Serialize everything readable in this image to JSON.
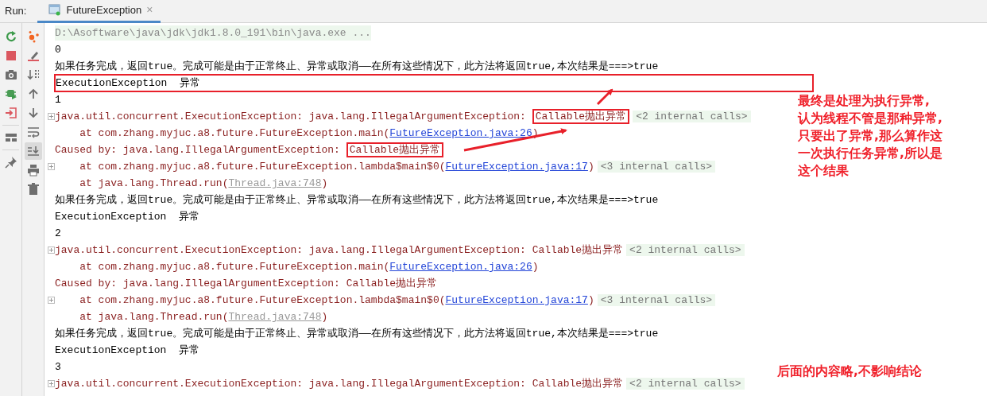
{
  "toolbar": {
    "label": "Run:",
    "tabs": [
      {
        "label": "FutureException",
        "selected": true,
        "close": "×"
      }
    ]
  },
  "console": [
    {
      "kind": "cmd",
      "fold": false,
      "boxed": false,
      "segments": [
        {
          "kind": "text",
          "text": "D:\\Asoftware\\java\\jdk\\jdk1.8.0_191\\bin\\java.exe ..."
        }
      ]
    },
    {
      "kind": "stdout",
      "fold": false,
      "boxed": false,
      "segments": [
        {
          "kind": "text",
          "text": "0"
        }
      ]
    },
    {
      "kind": "stdout",
      "fold": false,
      "boxed": false,
      "segments": [
        {
          "kind": "text",
          "text": "如果任务完成，返回true。完成可能是由于正常终止、异常或取消——在所有这些情况下，此方法将返回true,本次结果是===>true"
        }
      ]
    },
    {
      "kind": "stdout",
      "fold": false,
      "boxed": true,
      "segments": [
        {
          "kind": "text",
          "text": "ExecutionException  异常"
        }
      ]
    },
    {
      "kind": "stdout",
      "fold": false,
      "boxed": false,
      "segments": [
        {
          "kind": "text",
          "text": "1"
        }
      ]
    },
    {
      "kind": "stderr",
      "fold": true,
      "boxed": false,
      "segments": [
        {
          "kind": "text",
          "text": "java.util.concurrent.ExecutionException: java.lang.IllegalArgumentException: "
        },
        {
          "kind": "boxed",
          "text": "Callable抛出异常"
        },
        {
          "kind": "hint",
          "text": "<2 internal calls>"
        }
      ]
    },
    {
      "kind": "stderr",
      "fold": false,
      "boxed": false,
      "segments": [
        {
          "kind": "text",
          "text": "    at com.zhang.myjuc.a8.future.FutureException.main("
        },
        {
          "kind": "link",
          "text": "FutureException.java:26"
        },
        {
          "kind": "text",
          "text": ")"
        }
      ]
    },
    {
      "kind": "stderr",
      "fold": false,
      "boxed": false,
      "segments": [
        {
          "kind": "text",
          "text": "Caused by: java.lang.IllegalArgumentException: "
        },
        {
          "kind": "boxed",
          "text": "Callable抛出异常"
        }
      ]
    },
    {
      "kind": "stderr",
      "fold": true,
      "boxed": false,
      "segments": [
        {
          "kind": "text",
          "text": "    at com.zhang.myjuc.a8.future.FutureException.lambda$main$0("
        },
        {
          "kind": "link",
          "text": "FutureException.java:17"
        },
        {
          "kind": "text",
          "text": ")"
        },
        {
          "kind": "hint",
          "text": "<3 internal calls>"
        }
      ]
    },
    {
      "kind": "stderr",
      "fold": false,
      "boxed": false,
      "segments": [
        {
          "kind": "text",
          "text": "    at java.lang.Thread.run("
        },
        {
          "kind": "dim_link",
          "text": "Thread.java:748"
        },
        {
          "kind": "text",
          "text": ")"
        }
      ]
    },
    {
      "kind": "stdout",
      "fold": false,
      "boxed": false,
      "segments": [
        {
          "kind": "text",
          "text": "如果任务完成，返回true。完成可能是由于正常终止、异常或取消——在所有这些情况下，此方法将返回true,本次结果是===>true"
        }
      ]
    },
    {
      "kind": "stdout",
      "fold": false,
      "boxed": false,
      "segments": [
        {
          "kind": "text",
          "text": "ExecutionException  异常"
        }
      ]
    },
    {
      "kind": "stdout",
      "fold": false,
      "boxed": false,
      "segments": [
        {
          "kind": "text",
          "text": "2"
        }
      ]
    },
    {
      "kind": "stderr",
      "fold": true,
      "boxed": false,
      "segments": [
        {
          "kind": "text",
          "text": "java.util.concurrent.ExecutionException: java.lang.IllegalArgumentException: Callable抛出异常"
        },
        {
          "kind": "hint",
          "text": "<2 internal calls>"
        }
      ]
    },
    {
      "kind": "stderr",
      "fold": false,
      "boxed": false,
      "segments": [
        {
          "kind": "text",
          "text": "    at com.zhang.myjuc.a8.future.FutureException.main("
        },
        {
          "kind": "link",
          "text": "FutureException.java:26"
        },
        {
          "kind": "text",
          "text": ")"
        }
      ]
    },
    {
      "kind": "stderr",
      "fold": false,
      "boxed": false,
      "segments": [
        {
          "kind": "text",
          "text": "Caused by: java.lang.IllegalArgumentException: Callable抛出异常"
        }
      ]
    },
    {
      "kind": "stderr",
      "fold": true,
      "boxed": false,
      "segments": [
        {
          "kind": "text",
          "text": "    at com.zhang.myjuc.a8.future.FutureException.lambda$main$0("
        },
        {
          "kind": "link",
          "text": "FutureException.java:17"
        },
        {
          "kind": "text",
          "text": ")"
        },
        {
          "kind": "hint",
          "text": "<3 internal calls>"
        }
      ]
    },
    {
      "kind": "stderr",
      "fold": false,
      "boxed": false,
      "segments": [
        {
          "kind": "text",
          "text": "    at java.lang.Thread.run("
        },
        {
          "kind": "dim_link",
          "text": "Thread.java:748"
        },
        {
          "kind": "text",
          "text": ")"
        }
      ]
    },
    {
      "kind": "stdout",
      "fold": false,
      "boxed": false,
      "segments": [
        {
          "kind": "text",
          "text": "如果任务完成，返回true。完成可能是由于正常终止、异常或取消——在所有这些情况下，此方法将返回true,本次结果是===>true"
        }
      ]
    },
    {
      "kind": "stdout",
      "fold": false,
      "boxed": false,
      "segments": [
        {
          "kind": "text",
          "text": "ExecutionException  异常"
        }
      ]
    },
    {
      "kind": "stdout",
      "fold": false,
      "boxed": false,
      "segments": [
        {
          "kind": "text",
          "text": "3"
        }
      ]
    },
    {
      "kind": "stderr",
      "fold": true,
      "boxed": false,
      "segments": [
        {
          "kind": "text",
          "text": "java.util.concurrent.ExecutionException: java.lang.IllegalArgumentException: Callable抛出异常"
        },
        {
          "kind": "hint",
          "text": "<2 internal calls>"
        }
      ]
    }
  ],
  "annotations": {
    "note": [
      "最终是处理为执行异常,",
      "认为线程不管是那种异常,",
      "只要出了异常,那么算作这",
      "一次执行任务异常,所以是",
      "这个结果"
    ],
    "footer": "后面的内容略,不影响结论"
  }
}
